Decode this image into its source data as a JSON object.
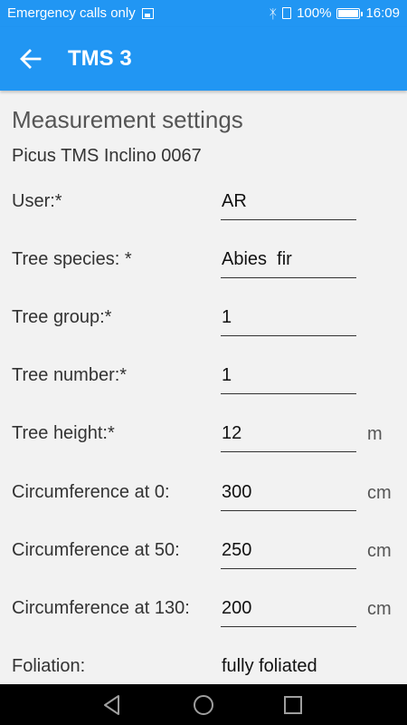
{
  "status_bar": {
    "carrier_text": "Emergency calls only",
    "battery": "100%",
    "time": "16:09"
  },
  "app_bar": {
    "title": "TMS 3"
  },
  "settings": {
    "section_title": "Measurement settings",
    "device_name": "Picus TMS Inclino 0067",
    "fields": [
      {
        "label": "User:*",
        "value": "AR",
        "unit": ""
      },
      {
        "label": "Tree species: *",
        "value": "Abies  fir",
        "unit": ""
      },
      {
        "label": "Tree group:*",
        "value": "1",
        "unit": ""
      },
      {
        "label": "Tree number:*",
        "value": "1",
        "unit": ""
      },
      {
        "label": "Tree height:*",
        "value": "12",
        "unit": "m"
      },
      {
        "label": "Circumference at 0:",
        "value": "300",
        "unit": "cm"
      },
      {
        "label": "Circumference at 50:",
        "value": "250",
        "unit": "cm"
      },
      {
        "label": "Circumference at 130:",
        "value": "200",
        "unit": "cm"
      },
      {
        "label": "Foliation:",
        "value": "fully foliated",
        "unit": ""
      }
    ]
  },
  "colors": {
    "primary": "#2196f3",
    "background": "#f2f2f2"
  }
}
